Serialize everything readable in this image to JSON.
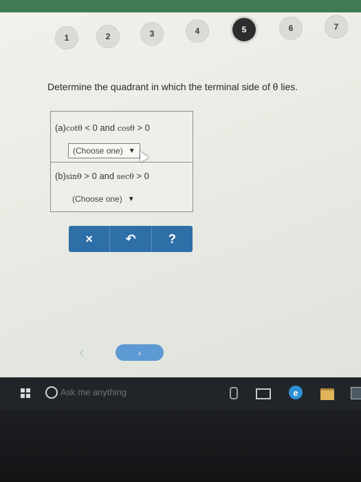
{
  "steps": [
    "1",
    "2",
    "3",
    "4",
    "5",
    "6",
    "7"
  ],
  "active_step": "5",
  "question": "Determine the quadrant in which the terminal side of θ lies.",
  "parts": [
    {
      "tag": "(a)",
      "f1": "cotθ",
      "op1": "< 0",
      "conj": "and",
      "f2": "cosθ",
      "op2": "> 0",
      "select": "(Choose one)"
    },
    {
      "tag": "(b)",
      "f1": "sinθ",
      "op1": "> 0",
      "conj": "and",
      "f2": "secθ",
      "op2": "> 0",
      "select": "(Choose one)"
    }
  ],
  "toolbar": {
    "clear": "×",
    "undo": "↶",
    "help": "?"
  },
  "nav": {
    "prev": "‹",
    "next": "›"
  },
  "taskbar": {
    "search_placeholder": "Ask me anything",
    "edge_label": "e"
  },
  "colors": {
    "accent": "#2f6fa8",
    "next": "#5d9ad3",
    "active_step": "#2b2d2f",
    "taskbar": "#20252a"
  },
  "icons": [
    "windows-start-icon",
    "cortana-search-icon",
    "microphone-icon",
    "task-view-icon",
    "edge-browser-icon",
    "file-explorer-icon",
    "store-icon",
    "cursor-icon"
  ]
}
